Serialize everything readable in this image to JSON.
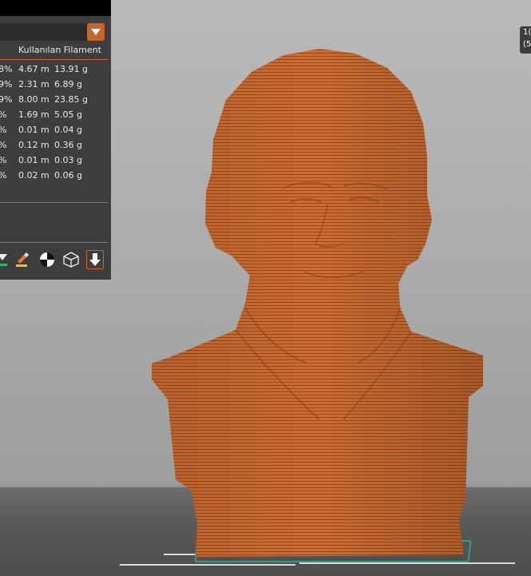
{
  "colors": {
    "model": "#d06a2b",
    "accent": "#c9642c",
    "panel": "#3d3d3d",
    "plate": "#2aa08c"
  },
  "panel": {
    "column_header": "Kullanılan Filament",
    "rows": [
      {
        "pct": "8%",
        "length": "4.67 m",
        "weight": "13.91 g"
      },
      {
        "pct": "9%",
        "length": "2.31 m",
        "weight": "6.89 g"
      },
      {
        "pct": "9%",
        "length": "8.00 m",
        "weight": "23.85 g"
      },
      {
        "pct": "%",
        "length": "1.69 m",
        "weight": "5.05 g"
      },
      {
        "pct": "%",
        "length": "0.01 m",
        "weight": "0.04 g"
      },
      {
        "pct": "%",
        "length": "0.12 m",
        "weight": "0.36 g"
      },
      {
        "pct": "%",
        "length": "0.01 m",
        "weight": "0.03 g"
      },
      {
        "pct": "%",
        "length": "0.02 m",
        "weight": "0.06 g"
      }
    ],
    "icons": [
      "support-blocker-icon",
      "paint-brush-icon",
      "color-contrast-icon",
      "wireframe-cube-icon",
      "download-arrow-icon"
    ]
  },
  "right_label": {
    "line1": "1(",
    "line2": "(5"
  }
}
